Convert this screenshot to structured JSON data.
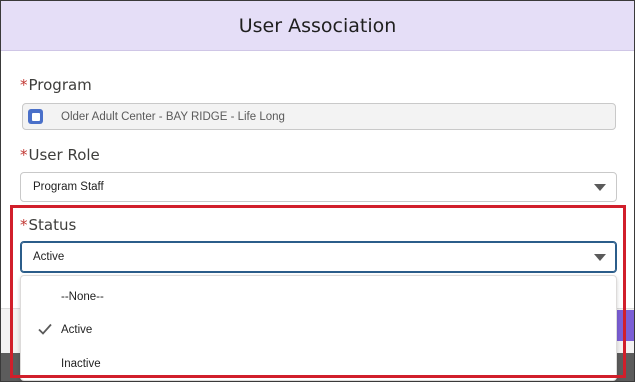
{
  "modal": {
    "title": "User Association"
  },
  "program": {
    "required_marker": "*",
    "label": "Program",
    "value": "Older Adult Center - BAY RIDGE - Life Long"
  },
  "user_role": {
    "required_marker": "*",
    "label": "User Role",
    "value": "Program Staff"
  },
  "status": {
    "required_marker": "*",
    "label": "Status",
    "value": "Active",
    "options": [
      {
        "label": "--None--",
        "selected": false
      },
      {
        "label": "Active",
        "selected": true
      },
      {
        "label": "Inactive",
        "selected": false
      }
    ]
  },
  "colors": {
    "header_bg": "#e5def7",
    "required": "#c23934",
    "highlight": "#d11f2b",
    "focus_border": "#2b5d8a"
  }
}
